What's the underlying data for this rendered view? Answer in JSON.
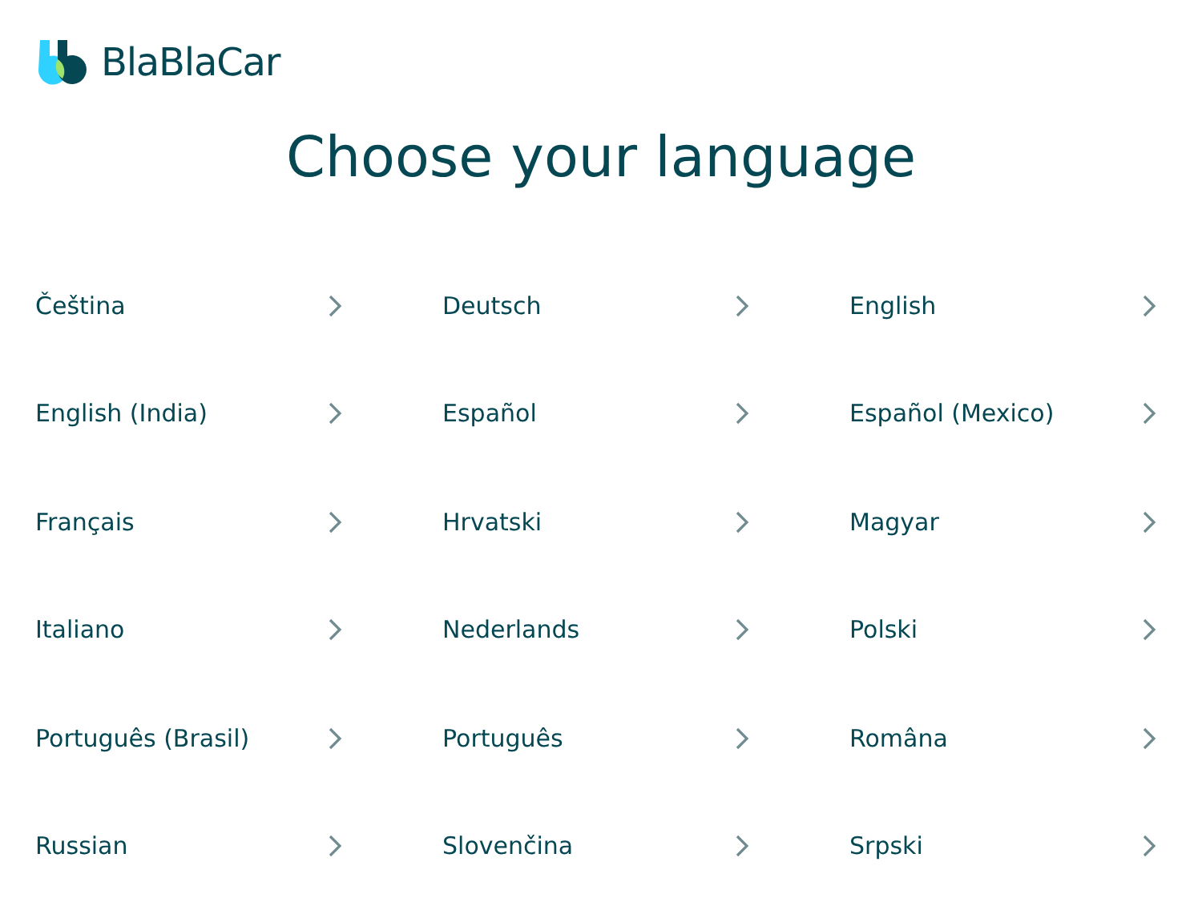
{
  "logo": {
    "text": "BlaBlaCar"
  },
  "title": "Choose your language",
  "languages": [
    {
      "label": "Čeština"
    },
    {
      "label": "Deutsch"
    },
    {
      "label": "English"
    },
    {
      "label": "English (India)"
    },
    {
      "label": "Español"
    },
    {
      "label": "Español (Mexico)"
    },
    {
      "label": "Français"
    },
    {
      "label": "Hrvatski"
    },
    {
      "label": "Magyar"
    },
    {
      "label": "Italiano"
    },
    {
      "label": "Nederlands"
    },
    {
      "label": "Polski"
    },
    {
      "label": "Português (Brasil)"
    },
    {
      "label": "Português"
    },
    {
      "label": "Româna"
    },
    {
      "label": "Russian"
    },
    {
      "label": "Slovenčina"
    },
    {
      "label": "Srpski"
    }
  ]
}
